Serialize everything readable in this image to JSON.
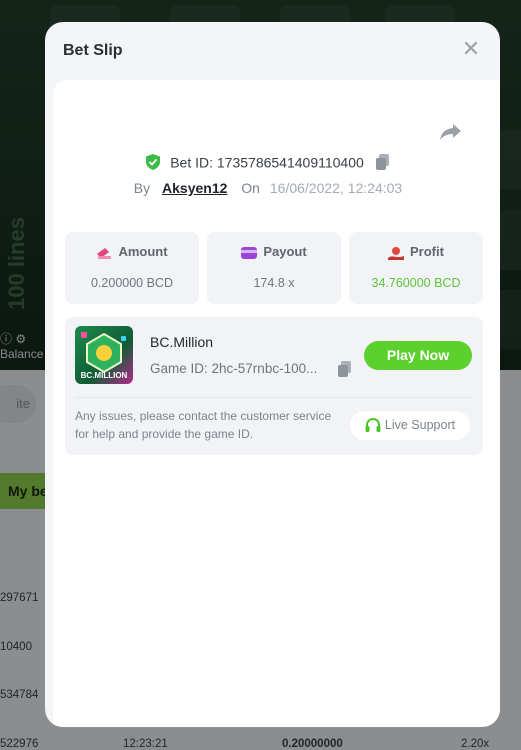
{
  "background": {
    "lines_label": "100 lines",
    "balance_label": "Balance",
    "pill_text": "ite",
    "my_bets_tab": "My be",
    "row_ids": [
      "297671",
      "10400",
      "534784",
      "522976"
    ],
    "last_row": {
      "time": "12:23:21",
      "amount": "0.20000000",
      "multiplier": "2.20x"
    }
  },
  "modal": {
    "title": "Bet Slip",
    "bet_id_label": "Bet ID:",
    "bet_id": "1735786541409110400",
    "by_label": "By",
    "username": "Aksyen12",
    "on_label": "On",
    "date": "16/06/2022, 12:24:03",
    "stats": [
      {
        "title": "Amount",
        "value": "0.200000 BCD",
        "icon": "amount-icon"
      },
      {
        "title": "Payout",
        "value": "174.8 x",
        "icon": "payout-icon"
      },
      {
        "title": "Profit",
        "value": "34.760000 BCD",
        "icon": "profit-icon",
        "color": "#5cc63a"
      }
    ],
    "game": {
      "name": "BC.Million",
      "thumb_label": "BC.MILLION",
      "id_label": "Game ID:",
      "id": "2hc-57rnbc-100...",
      "play_label": "Play Now",
      "issues_text": "Any issues, please contact the customer service for help and provide the game ID.",
      "support_label": "Live Support"
    }
  },
  "colors": {
    "accent_green": "#5cd12e",
    "profit_green": "#5cc63a",
    "shield_green": "#3dbb4a"
  }
}
